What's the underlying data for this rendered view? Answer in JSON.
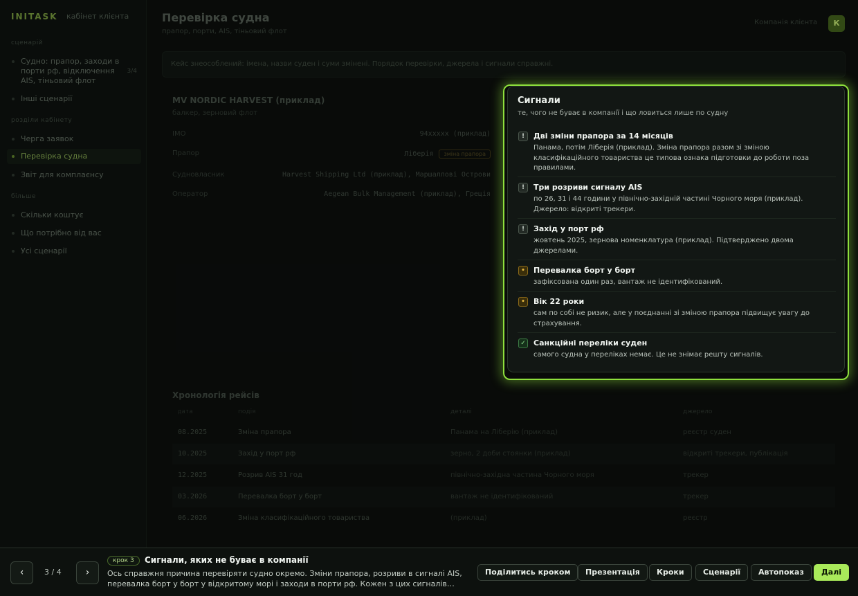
{
  "sidebar": {
    "brand": "INITASK",
    "brand_sub": "кабінет клієнта",
    "section1": "сценарій",
    "scenario_item": "Судно: прапор, заходи в порти рф, відключення AIS, тіньовий флот",
    "scenario_count": "3/4",
    "scenario_other": "Інші сценарії",
    "section2": "розділи кабінету",
    "items": [
      "Черга заявок",
      "Перевірка судна",
      "Звіт для комплаєнсу"
    ],
    "section3": "більше",
    "more_items": [
      "Скільки коштує",
      "Що потрібно від вас",
      "Усі сценарії"
    ]
  },
  "header": {
    "title": "Перевірка судна",
    "subtitle": "прапор, порти, AIS, тіньовий флот",
    "client": "Компанія клієнта",
    "avatar": "К"
  },
  "notice": "Кейс знеособлений: імена, назви суден і суми змінені. Порядок перевірки, джерела і сигнали справжні.",
  "ship": {
    "name": "MV NORDIC HARVEST (приклад)",
    "type": "балкер, зерновий флот",
    "rows": [
      {
        "k": "IMO",
        "v": "94xxxxx (приклад)"
      },
      {
        "k": "Прапор",
        "v": "Ліберія",
        "badge": "зміна прапора"
      },
      {
        "k": "Судновласник",
        "v": "Harvest Shipping Ltd (приклад), Маршаллові Острови"
      },
      {
        "k": "Оператор",
        "v": "Aegean Bulk Management (приклад), Греція"
      }
    ]
  },
  "timeline": {
    "title": "Хронологія рейсів",
    "headers": [
      "дата",
      "подія",
      "деталі",
      "джерело"
    ],
    "rows": [
      [
        "08.2025",
        "Зміна прапора",
        "Панама на Ліберію (приклад)",
        "реєстр суден"
      ],
      [
        "10.2025",
        "Захід у порт рф",
        "зерно, 2 доби стоянки (приклад)",
        "відкриті трекери, публікація"
      ],
      [
        "12.2025",
        "Розрив AIS 31 год",
        "північно-західна частина Чорного моря",
        "трекер"
      ],
      [
        "03.2026",
        "Перевалка борт у борт",
        "вантаж не ідентифікований",
        "трекер"
      ],
      [
        "06.2026",
        "Зміна класифікаційного товариства",
        "(приклад)",
        "реєстр"
      ]
    ]
  },
  "signals": {
    "title": "Сигнали",
    "subtitle": "те, чого не буває в компанії і що ловиться лише по судну",
    "items": [
      {
        "icon": "!",
        "kind": "alert",
        "title": "Дві зміни прапора за 14 місяців",
        "text": "Панама, потім Ліберія (приклад). Зміна прапора разом зі зміною класифікаційного товариства це типова ознака підготовки до роботи поза правилами."
      },
      {
        "icon": "!",
        "kind": "alert",
        "title": "Три розриви сигналу AIS",
        "text": "по 26, 31 і 44 години у північно-західній частині Чорного моря (приклад). Джерело: відкриті трекери."
      },
      {
        "icon": "!",
        "kind": "alert",
        "title": "Захід у порт рф",
        "text": "жовтень 2025, зернова номенклатура (приклад). Підтверджено двома джерелами."
      },
      {
        "icon": "•",
        "kind": "warn",
        "title": "Перевалка борт у борт",
        "text": "зафіксована один раз, вантаж не ідентифікований."
      },
      {
        "icon": "•",
        "kind": "warn",
        "title": "Вік 22 роки",
        "text": "сам по собі не ризик, але у поєднанні зі зміною прапора підвищує увагу до страхування."
      },
      {
        "icon": "✓",
        "kind": "ok",
        "title": "Санкційні переліки суден",
        "text": "самого судна у переліках немає. Це не знімає решту сигналів."
      }
    ]
  },
  "tour": {
    "prev": "‹",
    "next": "›",
    "page": "3 / 4",
    "step_badge": "крок 3",
    "step_title": "Сигнали, яких не буває в компанії",
    "step_text": "Ось справжня причина перевіряти судно окремо. Зміни прапора, розриви в сигналі AIS, перевалка борт у борт у відкритому морі і заходи в порти рф. Кожен з цих сигналів…",
    "actions": [
      "Поділитись кроком",
      "Презентація",
      "Кроки",
      "Сценарії",
      "Автопоказ"
    ],
    "primary": "Далі"
  }
}
